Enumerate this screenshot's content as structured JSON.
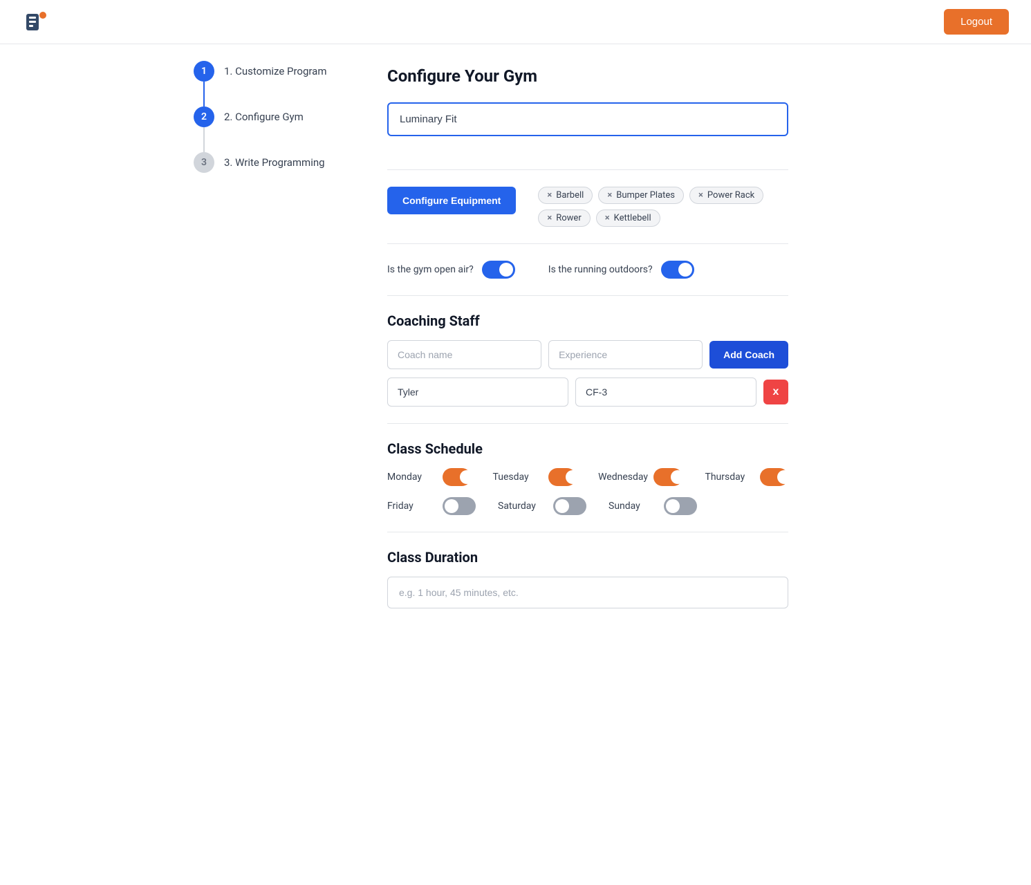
{
  "header": {
    "logout_label": "Logout"
  },
  "stepper": {
    "steps": [
      {
        "number": "1",
        "label": "1. Customize Program",
        "state": "active"
      },
      {
        "number": "2",
        "label": "2. Configure Gym",
        "state": "active"
      },
      {
        "number": "3",
        "label": "3. Write Programming",
        "state": "inactive"
      }
    ],
    "connectors": [
      "active",
      "inactive"
    ]
  },
  "form": {
    "section_title": "Configure Your Gym",
    "gym_name_value": "Luminary Fit",
    "gym_name_placeholder": "",
    "equipment": {
      "button_label": "Configure Equipment",
      "tags": [
        "Barbell",
        "Bumper Plates",
        "Power Rack",
        "Rower",
        "Kettlebell"
      ]
    },
    "toggles": {
      "open_air_label": "Is the gym open air?",
      "open_air_state": "on-blue",
      "running_outdoors_label": "Is the running outdoors?",
      "running_outdoors_state": "on-blue"
    },
    "coaching_staff": {
      "section_title": "Coaching Staff",
      "coach_name_placeholder": "Coach name",
      "experience_placeholder": "Experience",
      "add_button_label": "Add Coach",
      "coaches": [
        {
          "name": "Tyler",
          "experience": "CF-3"
        }
      ]
    },
    "class_schedule": {
      "section_title": "Class Schedule",
      "days": [
        {
          "label": "Monday",
          "state": "on-orange"
        },
        {
          "label": "Tuesday",
          "state": "on-orange"
        },
        {
          "label": "Wednesday",
          "state": "on-orange"
        },
        {
          "label": "Thursday",
          "state": "on-orange"
        },
        {
          "label": "Friday",
          "state": "off"
        },
        {
          "label": "Saturday",
          "state": "off"
        },
        {
          "label": "Sunday",
          "state": "off"
        }
      ]
    },
    "class_duration": {
      "section_title": "Class Duration",
      "placeholder": "e.g. 1 hour, 45 minutes, etc."
    }
  }
}
